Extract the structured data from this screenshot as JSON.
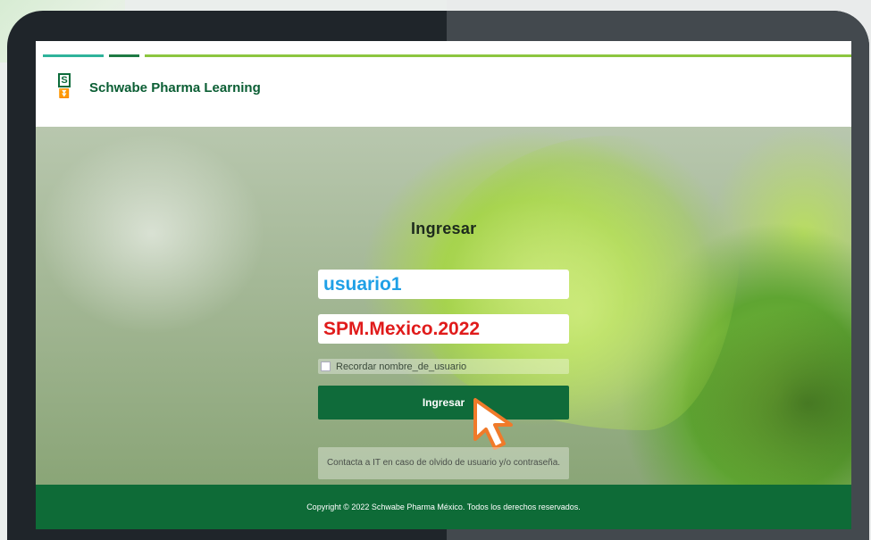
{
  "header": {
    "brand_name": "Schwabe Pharma Learning",
    "logo_icon": "schwabe-logo-icon"
  },
  "login": {
    "title": "Ingresar",
    "username_value": "usuario1",
    "password_value": "SPM.Mexico.2022",
    "remember_label": "Recordar nombre_de_usuario",
    "submit_label": "Ingresar",
    "help_text": "Contacta a IT en caso de olvido de usuario y/o contraseña."
  },
  "footer": {
    "copyright": "Copyright © 2022 Schwabe Pharma México. Todos los derechos reservados."
  },
  "colors": {
    "brand_green": "#0e6b37",
    "accent_teal": "#2fb39b",
    "accent_lime": "#8cc63f",
    "username_text": "#1fa0e6",
    "password_text": "#e01b1b",
    "cursor_outline": "#f07a2a"
  }
}
